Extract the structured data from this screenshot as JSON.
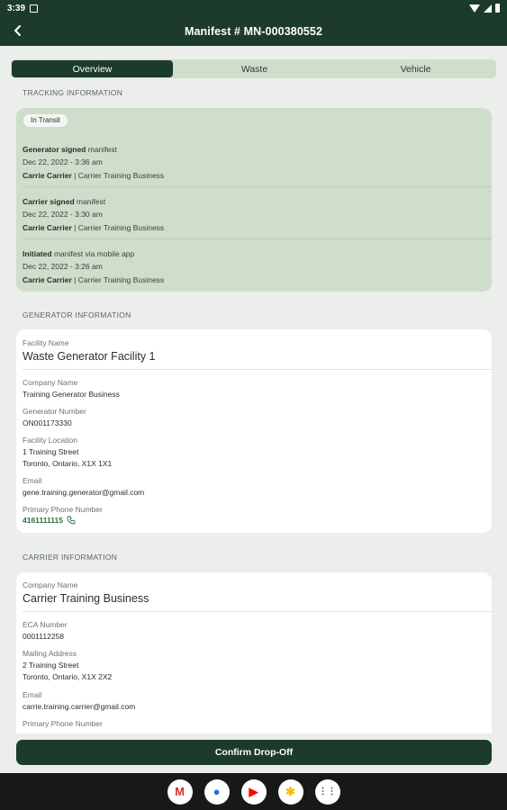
{
  "status_bar": {
    "time": "3:39",
    "icons": [
      "notification-icon",
      "wifi-icon",
      "signal-icon",
      "battery-icon"
    ]
  },
  "app_bar": {
    "title": "Manifest # MN-000380552",
    "back_icon": "back-arrow-icon"
  },
  "tabs": [
    {
      "label": "Overview",
      "active": true
    },
    {
      "label": "Waste",
      "active": false
    },
    {
      "label": "Vehicle",
      "active": false
    }
  ],
  "tracking": {
    "section_label": "TRACKING INFORMATION",
    "status_badge": "In Transit",
    "events": [
      {
        "actor_action": "Generator signed",
        "rest": " manifest",
        "datetime": "Dec 22, 2022 - 3:36 am",
        "person": "Carrie Carrier",
        "company": " | Carrier Training Business"
      },
      {
        "actor_action": "Carrier signed",
        "rest": " manifest",
        "datetime": "Dec 22, 2022 - 3:30 am",
        "person": "Carrie Carrier",
        "company": " | Carrier Training Business"
      },
      {
        "actor_action": "Initiated",
        "rest": " manifest via mobile app",
        "datetime": "Dec 22, 2022 - 3:26 am",
        "person": "Carrie Carrier",
        "company": " | Carrier Training Business"
      }
    ]
  },
  "generator": {
    "section_label": "GENERATOR INFORMATION",
    "facility_name_label": "Facility Name",
    "facility_name": "Waste Generator Facility 1",
    "company_name_label": "Company Name",
    "company_name": "Training Generator Business",
    "generator_number_label": "Generator Number",
    "generator_number": "ON001173330",
    "facility_location_label": "Facility Location",
    "facility_location_line1": "1 Training Street",
    "facility_location_line2": "Toronto, Ontario, X1X 1X1",
    "email_label": "Email",
    "email": "gene.training.generator@gmail.com",
    "phone_label": "Primary Phone Number",
    "phone": "4161111115"
  },
  "carrier": {
    "section_label": "CARRIER INFORMATION",
    "company_name_label": "Company Name",
    "company_name": "Carrier Training Business",
    "eca_label": "ECA Number",
    "eca": "0001112258",
    "mailing_label": "Mailing Address",
    "mailing_line1": "2 Training Street",
    "mailing_line2": "Toronto, Ontario, X1X 2X2",
    "email_label": "Email",
    "email": "carrie.training.carrier@gmail.com",
    "phone_label": "Primary Phone Number"
  },
  "confirm_button": "Confirm Drop-Off",
  "dock": {
    "apps": [
      {
        "name": "gmail-icon",
        "glyph": "M",
        "color": "#d93025"
      },
      {
        "name": "chrome-icon",
        "glyph": "●",
        "color": "#1a73e8"
      },
      {
        "name": "youtube-icon",
        "glyph": "▶",
        "color": "#ff0000"
      },
      {
        "name": "photos-icon",
        "glyph": "✱",
        "color": "#fbbc04"
      },
      {
        "name": "app-drawer-icon",
        "glyph": "⋮⋮",
        "color": "#3c4043"
      }
    ]
  },
  "colors": {
    "primary": "#1c3b2a",
    "tracking_bg": "#cfddcb",
    "background": "#eceeeb",
    "phone_link": "#2e6b3d"
  }
}
